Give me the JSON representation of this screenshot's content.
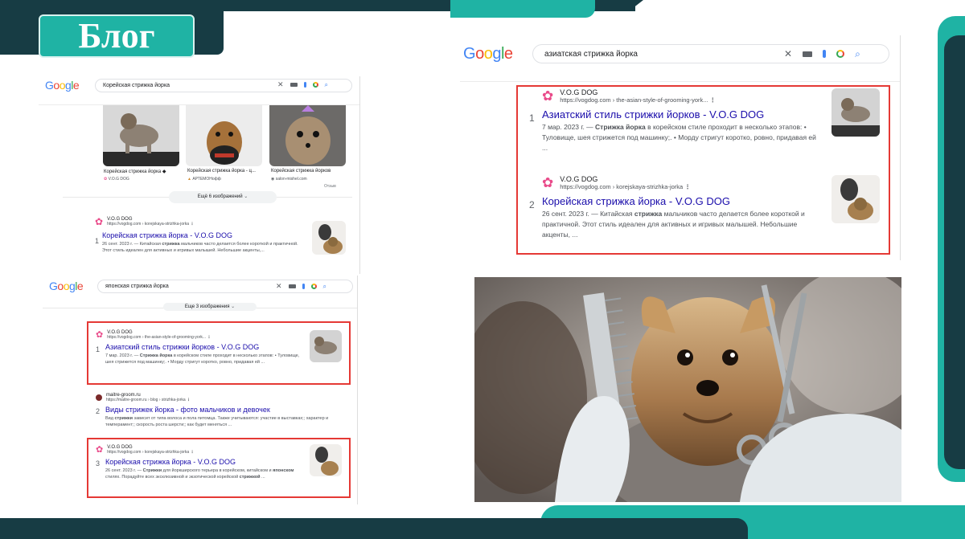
{
  "slide_title": "Блог",
  "google_logo_letters": [
    "G",
    "o",
    "o",
    "g",
    "l",
    "e"
  ],
  "colors": {
    "teal": "#1fb3a4",
    "dark": "#173c44",
    "link": "#1a0dab",
    "red_box": "#e53935",
    "paw": "#e94b8a"
  },
  "panel1": {
    "query": "Корейская стрижка йорка",
    "images": [
      {
        "caption": "Корейская стрижка йорка ◆",
        "source": "V.O.G DOG"
      },
      {
        "caption": "Корейская стрижка йорка - ц...",
        "source": "АРТЕМОНофф"
      },
      {
        "caption": "Корейская стрижка йорков",
        "source": "salon-mishel.com"
      }
    ],
    "feedback": "Отзыв",
    "more_images": "Ещё 6 изображений",
    "result": {
      "num": "1",
      "site": "V.O.G DOG",
      "url": "https://vogdog.com › korejskaya-strizhka-jorka",
      "title": "Корейская стрижка йорка - V.O.G DOG",
      "snippet_date": "26 сент. 2023 г. — Китайская ",
      "snippet_bold": "стрижка",
      "snippet_rest": " мальчиков часто делается более короткой и практичной. Этот стиль идеален для активных и игривых малышей. Небольшие акценты,..."
    }
  },
  "panel2": {
    "query": "японская стрижка йорка",
    "more_images": "Еще 3 изображения",
    "results": [
      {
        "num": "1",
        "site": "V.O.G DOG",
        "url": "https://vogdog.com › the-asian-style-of-grooming-york...",
        "title": "Азиатский стиль стрижки йорков - V.O.G DOG",
        "s1": "7 мар. 2023 г. — ",
        "b1": "Стрижка йорка",
        "s2": " в корейском стиле проходит в несколько этапов: • Туловище, шея стрижется под машинку;. • Морду стригут коротко, ровно, придавая ей ..."
      },
      {
        "num": "2",
        "site": "maitre-groom.ru",
        "url": "https://maitre-groom.ru › blog › strizhka-jorka",
        "title": "Виды стрижек йорка - фото мальчиков и девочек",
        "s1": "Вид ",
        "b1": "стрижки",
        "s2": " зависит от типа волоса и пола питомца. Также учитываются: участие в выставках;; характер и темперамент;; скорость роста шерсти;; как будет меняться ..."
      },
      {
        "num": "3",
        "site": "V.O.G DOG",
        "url": "https://vogdog.com › korejskaya-strizhka-jorka",
        "title": "Корейская стрижка йорка - V.O.G DOG",
        "s1": "26 сент. 2023 г. — ",
        "b1": "Стрижки",
        "s2": " для йоркширского терьера в корейском, китайском и ",
        "b2": "японском",
        "s3": " стилях. Порадуйте всех эксклюзивной и экзотической корейской ",
        "b3": "стрижкой",
        "s4": " ..."
      }
    ]
  },
  "panel3": {
    "query": "азиатская стрижка йорка",
    "results": [
      {
        "num": "1",
        "site": "V.O.G DOG",
        "url": "https://vogdog.com › the-asian-style-of-grooming-york...",
        "title": "Азиатский стиль стрижки йорков - V.O.G DOG",
        "s1": "7 мар. 2023 г. — ",
        "b1": "Стрижка йорка",
        "s2": " в корейском стиле проходит в несколько этапов: • Туловище, шея стрижется под машинку;. • Морду стригут коротко, ровно, придавая ей ..."
      },
      {
        "num": "2",
        "site": "V.O.G DOG",
        "url": "https://vogdog.com › korejskaya-strizhka-jorka",
        "title": "Корейская стрижка йорка - V.O.G DOG",
        "s1": "26 сент. 2023 г. — Китайская ",
        "b1": "стрижка",
        "s2": " мальчиков часто делается более короткой и практичной. Этот стиль идеален для активных и игривых малышей. Небольшие акценты, ..."
      }
    ]
  },
  "icons": {
    "paw": "paw-icon",
    "clear": "close-icon",
    "keyboard": "keyboard-icon",
    "mic": "mic-icon",
    "lens": "lens-icon",
    "search": "search-icon",
    "more": "more-vert-icon"
  }
}
